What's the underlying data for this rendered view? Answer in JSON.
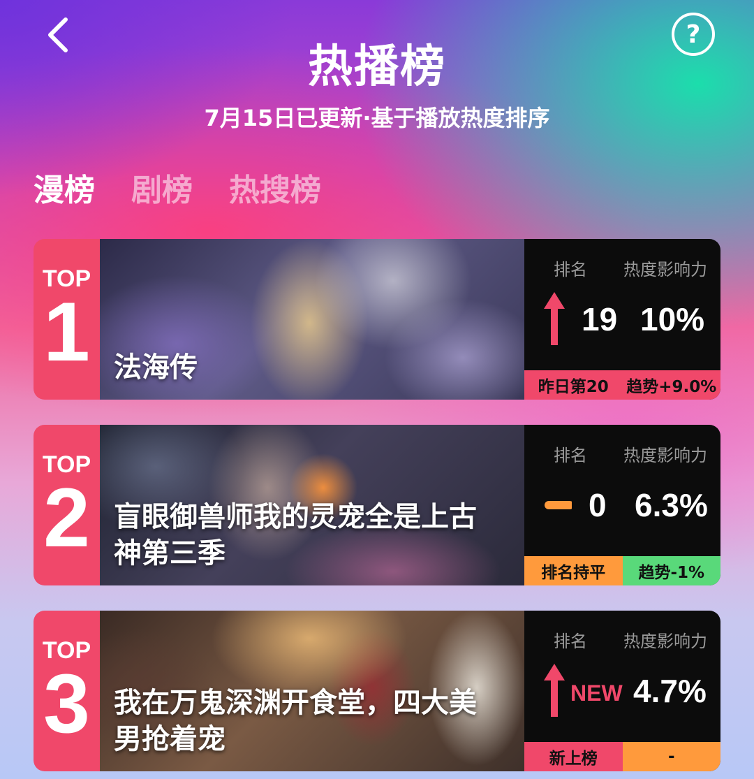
{
  "header": {
    "back_icon": "chevron-left-icon",
    "help_icon": "help-circle-icon",
    "help_glyph": "?",
    "title": "热播榜",
    "subtitle": "7月15日已更新·基于播放热度排序"
  },
  "tabs": [
    {
      "label": "漫榜",
      "active": true
    },
    {
      "label": "剧榜",
      "active": false
    },
    {
      "label": "热搜榜",
      "active": false
    }
  ],
  "stat_headers": {
    "rank": "排名",
    "heat": "热度影响力"
  },
  "colors": {
    "rank_badge": "#f0486a",
    "up_arrow": "#f0486a",
    "flat_dash": "#ff9a3c",
    "footer_pink": "#f0486a",
    "footer_orange": "#ff9a3c",
    "footer_green": "#59d97a"
  },
  "cards": [
    {
      "top_label": "TOP",
      "rank": "1",
      "title": "法海传",
      "trend": "up",
      "rank_change": "19",
      "heat": "10%",
      "footer_left": "昨日第20",
      "footer_right": "趋势+9.0%",
      "footer_left_color": "#f0486a",
      "footer_right_color": "#f0486a"
    },
    {
      "top_label": "TOP",
      "rank": "2",
      "title": "盲眼御兽师我的灵宠全是上古神第三季",
      "trend": "flat",
      "rank_change": "0",
      "heat": "6.3%",
      "footer_left": "排名持平",
      "footer_right": "趋势-1%",
      "footer_left_color": "#ff9a3c",
      "footer_right_color": "#59d97a"
    },
    {
      "top_label": "TOP",
      "rank": "3",
      "title": "我在万鬼深渊开食堂，四大美男抢着宠",
      "trend": "up",
      "rank_change": "NEW",
      "heat": "4.7%",
      "footer_left": "新上榜",
      "footer_right": "-",
      "footer_left_color": "#f0486a",
      "footer_right_color": "#ff9a3c"
    }
  ]
}
